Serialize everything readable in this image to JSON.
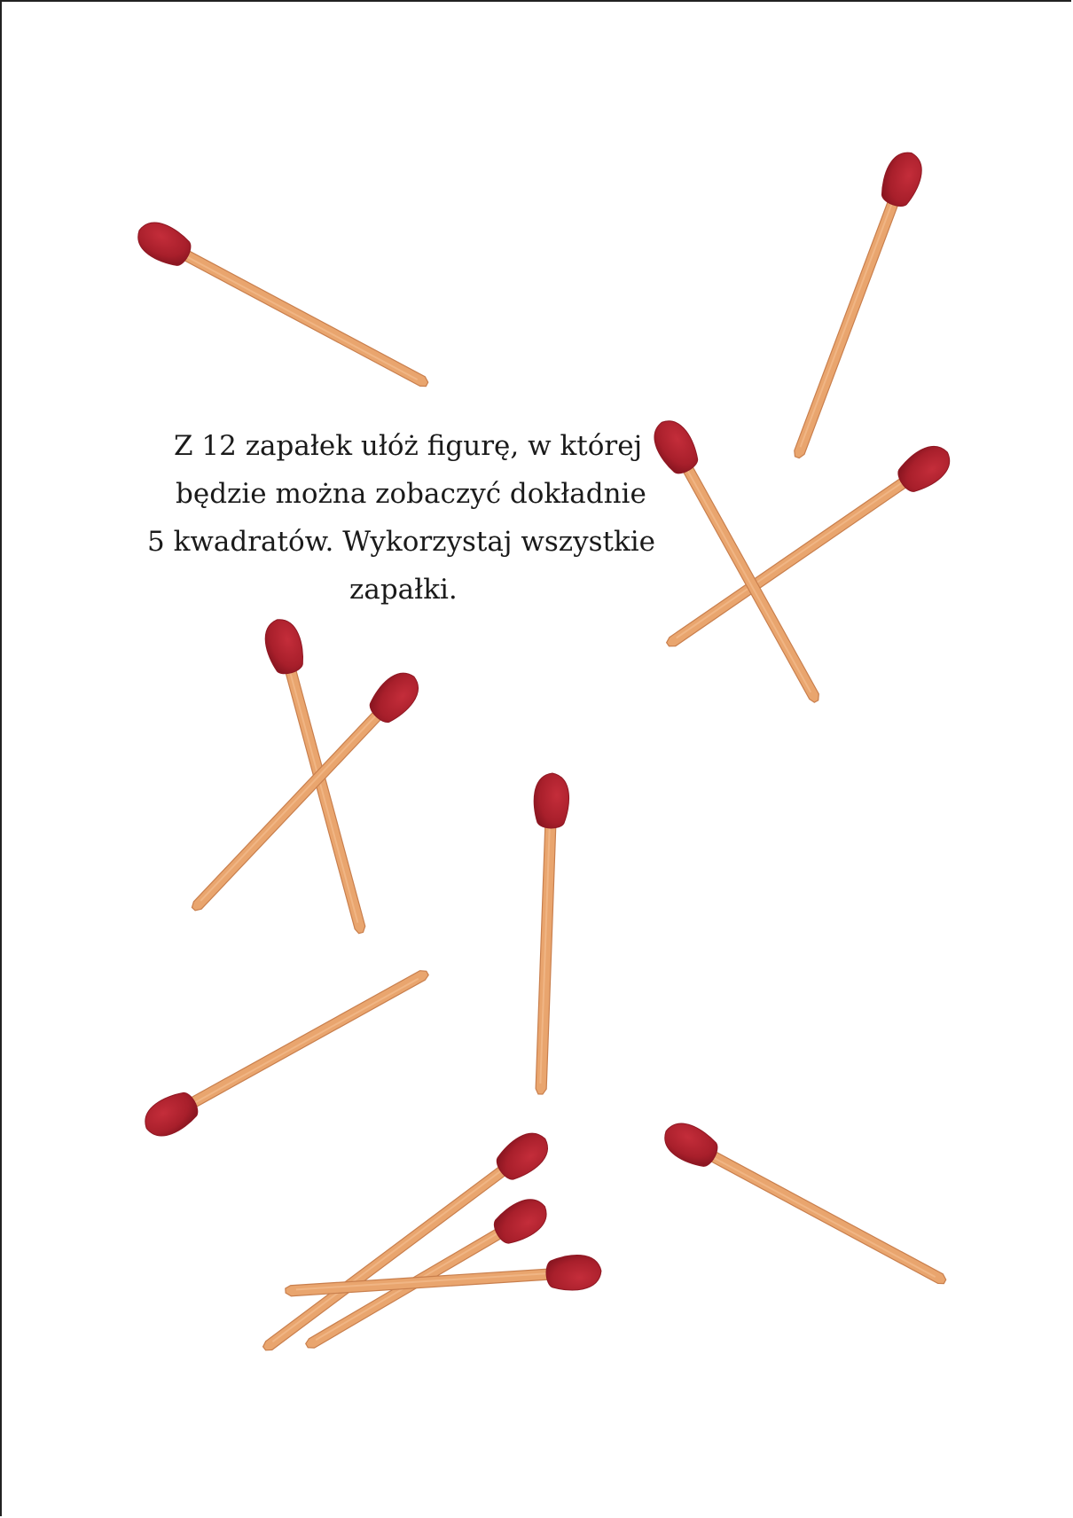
{
  "puzzle": {
    "lines": [
      "Z 12 zapałek ułóż figurę, w której",
      "będzie można zobaczyć dokładnie",
      "5 kwadratów. Wykorzystaj wszystkie",
      "zapałki."
    ]
  },
  "colors": {
    "stick": "#e9a56e",
    "stick_edge": "#c97f4d",
    "head": "#b5232f",
    "head_dark": "#8f1722",
    "text": "#1a1a1a"
  },
  "matches_count": 12
}
